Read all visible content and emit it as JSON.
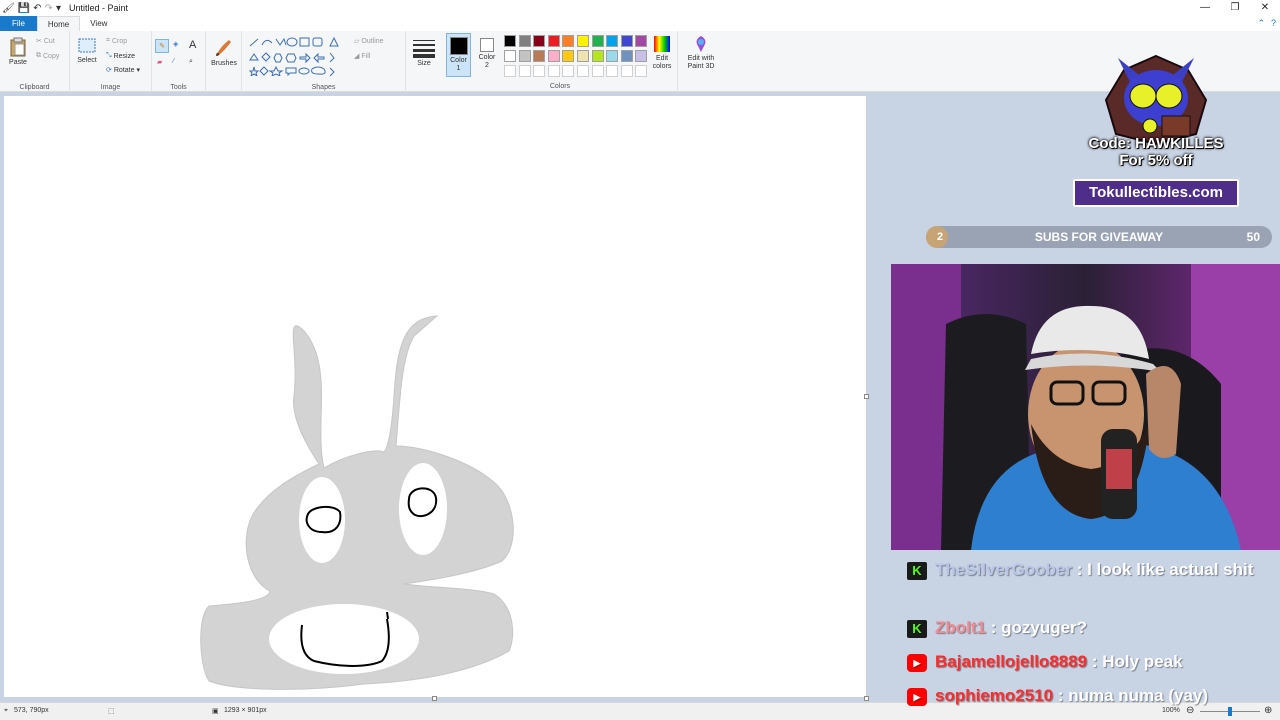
{
  "window": {
    "title": "Untitled - Paint",
    "controls": [
      "—",
      "❐",
      "✕"
    ]
  },
  "menu": {
    "file": "File",
    "home": "Home",
    "view": "View"
  },
  "ribbon": {
    "clipboard": {
      "label": "Clipboard",
      "paste": "Paste",
      "cut": "Cut",
      "copy": "Copy"
    },
    "image": {
      "label": "Image",
      "select": "Select",
      "crop": "Crop",
      "resize": "Resize",
      "rotate": "Rotate"
    },
    "tools": {
      "label": "Tools"
    },
    "brushes": {
      "label": "Brushes"
    },
    "shapes": {
      "label": "Shapes",
      "outline": "Outline",
      "fill": "Fill"
    },
    "size": {
      "label": "Size"
    },
    "colors": {
      "label": "Colors",
      "color1": "Color 1",
      "color2": "Color 2",
      "edit_colors": "Edit colors",
      "edit_3d": "Edit with Paint 3D",
      "color1_value": "#000000",
      "color2_value": "#ffffff",
      "palette_row1": [
        "#000000",
        "#7f7f7f",
        "#880015",
        "#ed1c24",
        "#ff7f27",
        "#fff200",
        "#22b14c",
        "#00a2e8",
        "#3f48cc",
        "#a349a4"
      ],
      "palette_row2": [
        "#ffffff",
        "#c3c3c3",
        "#b97a57",
        "#ffaec9",
        "#ffc90e",
        "#efe4b0",
        "#b5e61d",
        "#99d9ea",
        "#7092be",
        "#c8bfe7"
      ]
    }
  },
  "status": {
    "cursor_position": "573, 790px",
    "image_size": "1293 × 901px",
    "zoom": "100%"
  },
  "overlay": {
    "promo_code_line1": "Code: HAWKILLES",
    "promo_code_line2": "For 5% off",
    "promo_site": "Tokullectibles.com",
    "subs": {
      "current": "2",
      "label": "SUBS FOR GIVEAWAY",
      "goal": "50",
      "progress": 0.04
    },
    "chat": [
      {
        "platform": "kick",
        "user": "TheSilverGoober",
        "user_color": "#b9c6e8",
        "text": " : I look like actual shit"
      },
      {
        "platform": "kick",
        "user": "Zbolt1",
        "user_color": "#f28b93",
        "text": " : gozyuger?"
      },
      {
        "platform": "youtube",
        "user": "Bajamellojello8889",
        "user_color": "#ff2c2c",
        "text": " : Holy peak"
      },
      {
        "platform": "youtube",
        "user": "sophiemo2510",
        "user_color": "#ff2c2c",
        "text": " : numa numa (yay)"
      }
    ]
  }
}
